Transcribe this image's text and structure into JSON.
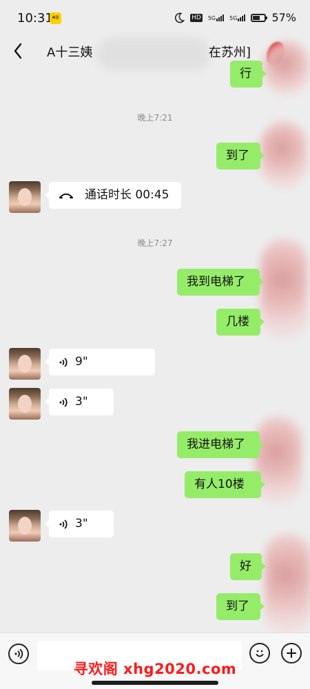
{
  "status_bar": {
    "time": "10:31",
    "app_badge": "美团",
    "signal_a": "5G",
    "signal_b": "5G",
    "hd": "HD",
    "battery": "57%",
    "battery_level": 0.57
  },
  "header": {
    "title_prefix": "A十三姨",
    "title_suffix": "在苏州]"
  },
  "chat": {
    "sent_top": "行",
    "time_1": "晚上7:21",
    "sent_1": "到了",
    "call_text": "通话时长 00:45",
    "time_2": "晚上7:27",
    "sent_2": "我到电梯了",
    "sent_3": "几楼",
    "voice_1": "9\"",
    "voice_2": "3\"",
    "sent_4": "我进电梯了",
    "sent_5": "有人10楼",
    "voice_3": "3\"",
    "sent_6": "好",
    "sent_7": "到了"
  },
  "bottom_bar": {
    "watermark": "寻欢阁 xhg2020.com"
  },
  "icons": {
    "back": "back-icon",
    "moon": "moon-icon",
    "voice": "voice-icon",
    "emoji": "emoji-icon",
    "plus": "plus-icon",
    "call": "call-icon"
  },
  "colors": {
    "background": "#ededed",
    "sent_bubble": "#95ec69",
    "received_bubble": "#ffffff",
    "watermark": "#ff1a1a"
  }
}
